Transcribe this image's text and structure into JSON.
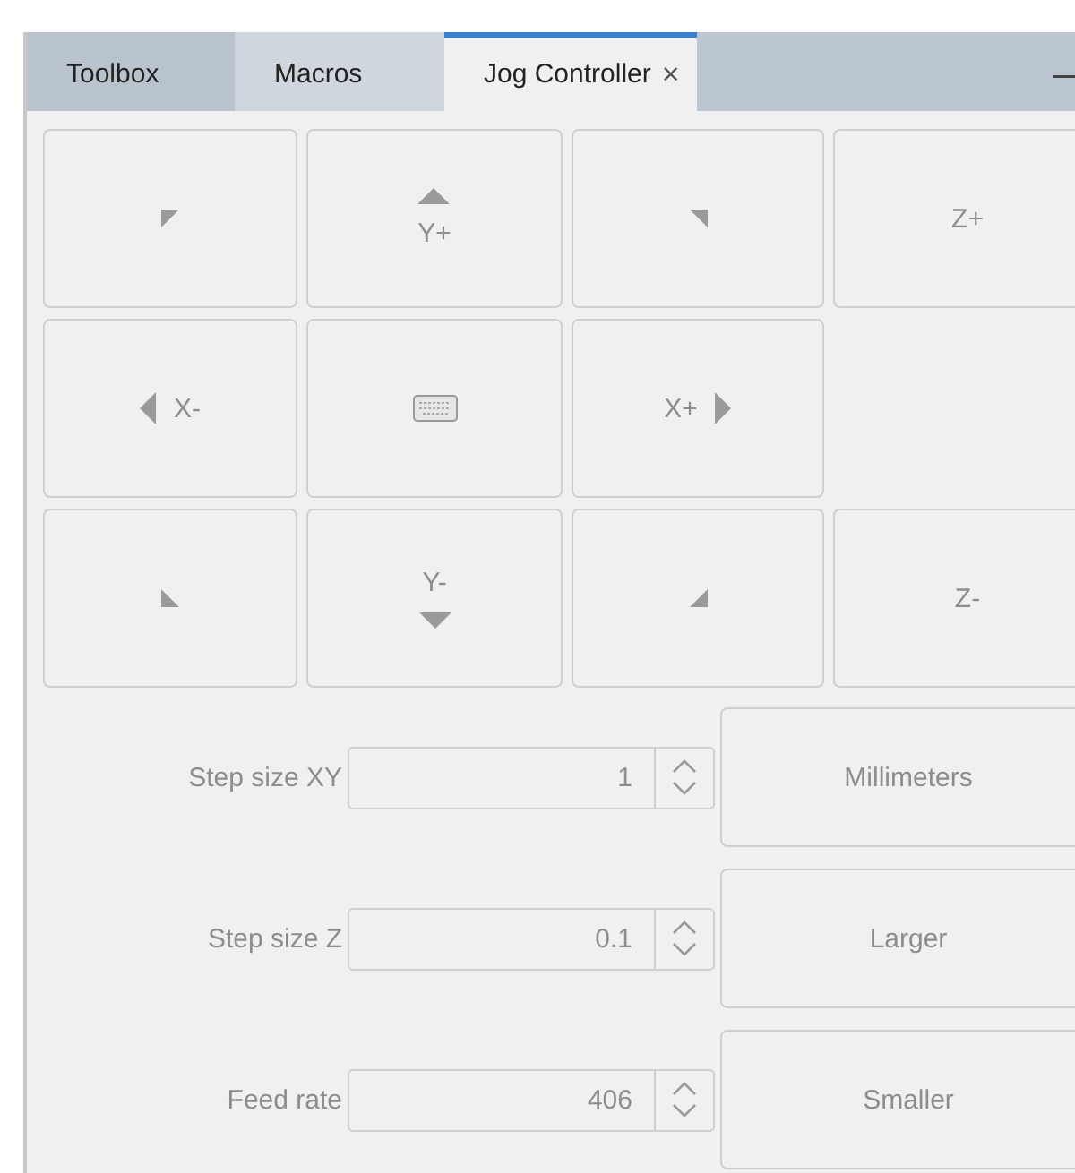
{
  "tabs": [
    {
      "label": "Toolbox",
      "selected": false
    },
    {
      "label": "Macros",
      "selected": false
    },
    {
      "label": "Jog Controller",
      "selected": true,
      "close": "×"
    }
  ],
  "jog_buttons": [
    {
      "kind": "nw",
      "disabled": true
    },
    {
      "kind": "n",
      "label": "Y+",
      "disabled": true
    },
    {
      "kind": "ne",
      "disabled": true
    },
    {
      "kind": "text",
      "label": "Z+",
      "disabled": true
    },
    {
      "kind": "w",
      "label": "X-",
      "disabled": true
    },
    {
      "kind": "keyboard",
      "disabled": true
    },
    {
      "kind": "e",
      "label": "X+",
      "disabled": true
    },
    {
      "kind": "blank"
    },
    {
      "kind": "sw",
      "disabled": true
    },
    {
      "kind": "s",
      "label": "Y-",
      "disabled": true
    },
    {
      "kind": "se",
      "disabled": true
    },
    {
      "kind": "text",
      "label": "Z-",
      "disabled": true
    }
  ],
  "settings": [
    {
      "label": "Step size XY",
      "value": "1",
      "button": "Millimeters",
      "disabled": true
    },
    {
      "label": "Step size Z",
      "value": "0.1",
      "button": "Larger",
      "disabled": true
    },
    {
      "label": "Feed rate",
      "value": "406",
      "button": "Smaller",
      "disabled": true
    }
  ]
}
